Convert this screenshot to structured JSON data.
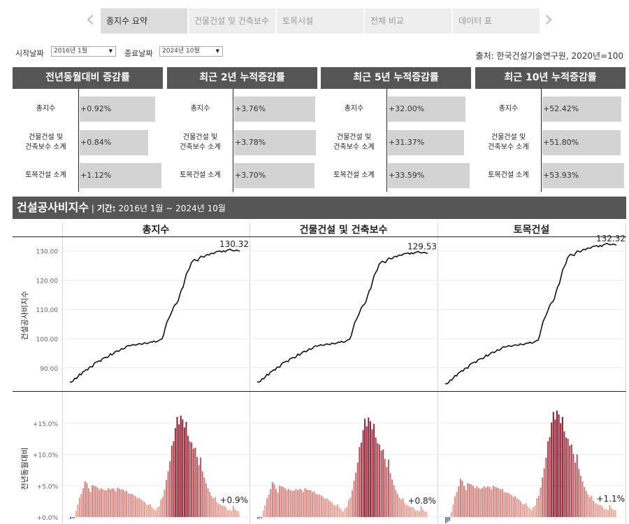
{
  "tabs": {
    "prev_icon": "chevron-left-icon",
    "next_icon": "chevron-right-icon",
    "items": [
      {
        "label": "종지수 요약",
        "active": true
      },
      {
        "label": "건물건설 및 건축보수",
        "active": false
      },
      {
        "label": "토목시설",
        "active": false
      },
      {
        "label": "전체 비교",
        "active": false
      },
      {
        "label": "데이터 표",
        "active": false
      }
    ]
  },
  "filters": {
    "start_label": "시작날짜",
    "start_value": "2016년 1월",
    "end_label": "종료날짜",
    "end_value": "2024년 10월"
  },
  "source": "출처: 한국건설기술연구원, 2020년=100",
  "panels": [
    {
      "title": "전년동월대비 증감률",
      "rows": [
        {
          "label": "총지수",
          "value": "+0.92%",
          "fill": 0.92
        },
        {
          "label": "건물건설 및\n건축보수 소계",
          "value": "+0.84%",
          "fill": 0.84
        },
        {
          "label": "토목건설 소계",
          "value": "+1.12%",
          "fill": 1.0
        }
      ]
    },
    {
      "title": "최근 2년 누적증감률",
      "rows": [
        {
          "label": "총지수",
          "value": "+3.76%",
          "fill": 0.99
        },
        {
          "label": "건물건설 및\n건축보수 소계",
          "value": "+3.78%",
          "fill": 1.0
        },
        {
          "label": "토목건설 소계",
          "value": "+3.70%",
          "fill": 0.98
        }
      ]
    },
    {
      "title": "최근 5년 누적증감률",
      "rows": [
        {
          "label": "총지수",
          "value": "+32.00%",
          "fill": 0.95
        },
        {
          "label": "건물건설 및\n건축보수 소계",
          "value": "+31.37%",
          "fill": 0.93
        },
        {
          "label": "토목건설 소계",
          "value": "+33.59%",
          "fill": 1.0
        }
      ]
    },
    {
      "title": "최근 10년 누적증감률",
      "rows": [
        {
          "label": "총지수",
          "value": "+52.42%",
          "fill": 0.97
        },
        {
          "label": "건물건설 및\n건축보수 소계",
          "value": "+51.80%",
          "fill": 0.96
        },
        {
          "label": "토목건설 소계",
          "value": "+53.93%",
          "fill": 1.0
        }
      ]
    }
  ],
  "section": {
    "title": "건설공사비지수",
    "separator": " | ",
    "period_label": "기간:",
    "period_value": " 2016년 1월 ~ 2024년 10월"
  },
  "columns": [
    "총지수",
    "건물건설 및 건축보수",
    "토목건설"
  ],
  "y_titles": {
    "index": "건설공사비지수",
    "yoy": "전년동월대비"
  },
  "colors": {
    "header_bg": "#555555",
    "bar_fill": "#d3d3d3",
    "line": "#111111",
    "yoy_low": "#f2b3a3",
    "yoy_high": "#8b1a2e",
    "yoy_negative": "#5b7fb6"
  },
  "chart_data": [
    {
      "type": "line",
      "title": "",
      "ylabel": "건설공사비지수",
      "x_range": [
        "2016-01",
        "2024-10"
      ],
      "ylim": [
        83,
        134
      ],
      "yticks": [
        90.0,
        100.0,
        110.0,
        120.0,
        130.0
      ],
      "ytick_labels": [
        "90.00",
        "100.00",
        "110.00",
        "120.00",
        "130.00"
      ],
      "grid": true,
      "series": [
        {
          "name": "총지수",
          "end_label": "130.32",
          "values": [
            85.2,
            85.1,
            85.5,
            86.4,
            86.3,
            87.0,
            87.9,
            87.6,
            88.6,
            88.9,
            89.4,
            89.3,
            90.2,
            90.4,
            90.3,
            91.5,
            91.9,
            92.1,
            92.4,
            92.2,
            93.1,
            93.4,
            93.6,
            93.5,
            93.9,
            94.8,
            94.4,
            94.9,
            95.5,
            95.8,
            95.6,
            96.0,
            96.6,
            96.4,
            96.7,
            97.4,
            97.6,
            97.5,
            97.7,
            98.0,
            97.8,
            97.8,
            98.1,
            98.3,
            98.1,
            98.1,
            98.6,
            98.4,
            98.3,
            98.6,
            98.9,
            98.8,
            99.2,
            98.8,
            99.0,
            99.4,
            99.7,
            99.9,
            101.4,
            103.7,
            105.7,
            106.8,
            107.9,
            109.2,
            110.7,
            111.6,
            112.0,
            113.0,
            115.1,
            116.8,
            117.6,
            119.9,
            122.1,
            123.1,
            124.1,
            125.9,
            126.6,
            127.1,
            126.8,
            126.6,
            127.5,
            128.2,
            128.0,
            127.9,
            128.5,
            128.8,
            128.6,
            129.1,
            129.2,
            129.1,
            129.6,
            129.8,
            129.9,
            130.0,
            129.6,
            130.1,
            129.7,
            130.2,
            130.4,
            130.6,
            130.3,
            130.0,
            130.1,
            130.32,
            130.1,
            129.9
          ]
        },
        {
          "name": "건물건설 및 건축보수",
          "end_label": "129.53",
          "values": [
            85.2,
            85.1,
            85.4,
            86.3,
            86.2,
            86.9,
            87.8,
            87.5,
            88.5,
            88.8,
            89.3,
            89.2,
            90.1,
            90.3,
            90.2,
            91.4,
            91.8,
            92.0,
            92.3,
            92.1,
            93.0,
            93.3,
            93.5,
            93.4,
            93.8,
            94.7,
            94.3,
            94.8,
            95.4,
            95.7,
            95.5,
            95.9,
            96.5,
            96.3,
            96.6,
            97.3,
            97.5,
            97.4,
            97.6,
            97.9,
            97.7,
            97.7,
            98.0,
            98.2,
            98.0,
            98.0,
            98.5,
            98.3,
            98.2,
            98.5,
            98.8,
            98.7,
            99.1,
            98.7,
            98.9,
            99.3,
            99.6,
            99.8,
            101.2,
            103.4,
            105.4,
            106.5,
            107.6,
            108.9,
            110.4,
            111.3,
            111.7,
            112.7,
            114.7,
            116.4,
            117.2,
            119.5,
            121.6,
            122.6,
            123.6,
            125.4,
            126.0,
            126.5,
            126.2,
            126.0,
            126.9,
            127.6,
            127.4,
            127.3,
            127.9,
            128.2,
            128.0,
            128.5,
            128.6,
            128.5,
            129.0,
            129.1,
            129.2,
            129.3,
            128.9,
            129.4,
            129.0,
            129.4,
            129.6,
            129.8,
            129.5,
            129.3,
            129.4,
            129.53,
            129.3,
            129.1
          ]
        },
        {
          "name": "토목건설",
          "end_label": "132.32",
          "values": [
            84.6,
            84.5,
            84.9,
            85.8,
            85.8,
            86.5,
            87.4,
            87.2,
            88.2,
            88.5,
            89.0,
            88.9,
            89.8,
            90.0,
            89.9,
            91.1,
            91.5,
            91.7,
            92.0,
            91.8,
            92.7,
            93.0,
            93.2,
            93.1,
            93.5,
            94.4,
            94.0,
            94.5,
            95.1,
            95.4,
            95.2,
            95.6,
            96.2,
            96.0,
            96.3,
            97.0,
            97.2,
            97.1,
            97.3,
            97.6,
            97.4,
            97.4,
            97.7,
            97.9,
            97.7,
            97.7,
            98.2,
            98.0,
            97.9,
            98.2,
            98.5,
            98.4,
            98.8,
            98.4,
            98.6,
            99.0,
            99.3,
            99.5,
            101.1,
            103.6,
            105.8,
            107.0,
            108.2,
            109.6,
            111.2,
            112.2,
            112.6,
            113.7,
            116.0,
            117.8,
            118.7,
            121.1,
            123.5,
            124.6,
            125.7,
            127.6,
            128.4,
            128.9,
            128.6,
            128.4,
            129.3,
            130.0,
            129.8,
            129.7,
            130.3,
            130.6,
            130.4,
            130.9,
            131.0,
            130.9,
            131.4,
            131.6,
            131.7,
            131.8,
            131.4,
            131.9,
            131.5,
            132.1,
            132.3,
            132.6,
            132.4,
            132.1,
            132.2,
            132.32,
            132.2,
            132.0
          ]
        }
      ]
    },
    {
      "type": "bar",
      "title": "",
      "ylabel": "전년동월대비",
      "ylim": [
        0,
        17
      ],
      "yticks": [
        0,
        5,
        10,
        15
      ],
      "ytick_labels": [
        "+0.0%",
        "+5.0%",
        "+10.0%",
        "+15.0%"
      ],
      "grid": true,
      "series": [
        {
          "name": "총지수",
          "end_label": "+0.9%",
          "values": [
            -0.3,
            -0.2,
            -0.2,
            1.0,
            2.0,
            3.1,
            3.7,
            4.6,
            5.7,
            5.4,
            4.6,
            4.0,
            5.1,
            5.0,
            4.9,
            4.7,
            4.4,
            4.6,
            4.4,
            4.3,
            4.3,
            4.6,
            4.4,
            4.6,
            4.5,
            4.1,
            4.7,
            4.5,
            4.4,
            4.4,
            4.1,
            4.2,
            3.8,
            3.7,
            3.7,
            3.5,
            3.3,
            3.0,
            3.1,
            2.8,
            2.6,
            2.4,
            2.0,
            1.9,
            2.1,
            1.6,
            1.3,
            1.0,
            1.5,
            1.7,
            2.8,
            3.2,
            4.4,
            5.9,
            7.3,
            8.9,
            11.4,
            12.1,
            14.2,
            16.0,
            14.8,
            16.2,
            15.6,
            14.3,
            15.2,
            13.0,
            12.1,
            11.9,
            10.9,
            11.1,
            9.6,
            8.3,
            9.5,
            7.3,
            6.3,
            5.4,
            4.6,
            4.0,
            3.4,
            3.0,
            3.2,
            2.4,
            2.1,
            2.0,
            1.8,
            1.8,
            1.6,
            1.1,
            1.2,
            1.0,
            1.8,
            1.3,
            1.0,
            0.9
          ]
        },
        {
          "name": "건물건설 및 건축보수",
          "end_label": "+0.8%",
          "values": [
            -0.3,
            -0.2,
            -0.2,
            1.0,
            1.9,
            3.0,
            3.6,
            4.5,
            5.6,
            5.3,
            4.5,
            3.9,
            5.0,
            4.9,
            4.8,
            4.6,
            4.3,
            4.5,
            4.3,
            4.2,
            4.2,
            4.5,
            4.3,
            4.5,
            4.4,
            4.0,
            4.6,
            4.4,
            4.3,
            4.3,
            4.0,
            4.1,
            3.7,
            3.6,
            3.6,
            3.4,
            3.2,
            2.9,
            3.0,
            2.7,
            2.5,
            2.3,
            1.9,
            1.8,
            2.0,
            1.5,
            1.2,
            0.9,
            1.4,
            1.6,
            2.7,
            3.1,
            4.3,
            5.8,
            7.1,
            8.7,
            11.2,
            11.9,
            13.9,
            15.7,
            14.5,
            15.9,
            15.3,
            14.0,
            14.9,
            12.7,
            11.8,
            11.6,
            10.6,
            10.8,
            9.3,
            8.0,
            9.2,
            7.0,
            6.0,
            5.1,
            4.3,
            3.7,
            3.1,
            2.8,
            3.0,
            2.2,
            1.9,
            1.8,
            1.6,
            1.6,
            1.4,
            1.0,
            1.1,
            0.9,
            1.7,
            1.2,
            0.9,
            0.8
          ]
        },
        {
          "name": "토목건설",
          "end_label": "+1.1%",
          "values": [
            -1.0,
            -0.8,
            -0.6,
            0.8,
            2.0,
            3.3,
            4.0,
            4.9,
            6.1,
            5.8,
            5.0,
            4.3,
            5.4,
            5.3,
            5.2,
            5.0,
            4.6,
            4.9,
            4.6,
            4.5,
            4.6,
            4.9,
            4.7,
            4.9,
            4.8,
            4.4,
            5.0,
            4.8,
            4.7,
            4.6,
            4.4,
            4.5,
            4.0,
            3.9,
            3.9,
            3.7,
            3.5,
            3.2,
            3.3,
            3.0,
            2.8,
            2.5,
            2.1,
            2.0,
            2.2,
            1.7,
            1.4,
            1.1,
            1.6,
            1.8,
            3.0,
            3.4,
            4.7,
            6.3,
            7.8,
            9.5,
            12.1,
            12.8,
            15.1,
            16.8,
            15.6,
            17.0,
            16.4,
            15.0,
            16.0,
            13.7,
            12.7,
            12.5,
            11.4,
            11.6,
            10.1,
            8.7,
            10.0,
            7.7,
            6.6,
            5.7,
            4.8,
            4.2,
            3.6,
            3.2,
            3.4,
            2.6,
            2.2,
            2.1,
            1.9,
            1.9,
            1.7,
            1.2,
            1.3,
            1.1,
            1.9,
            1.4,
            1.1,
            1.1
          ]
        }
      ]
    }
  ]
}
